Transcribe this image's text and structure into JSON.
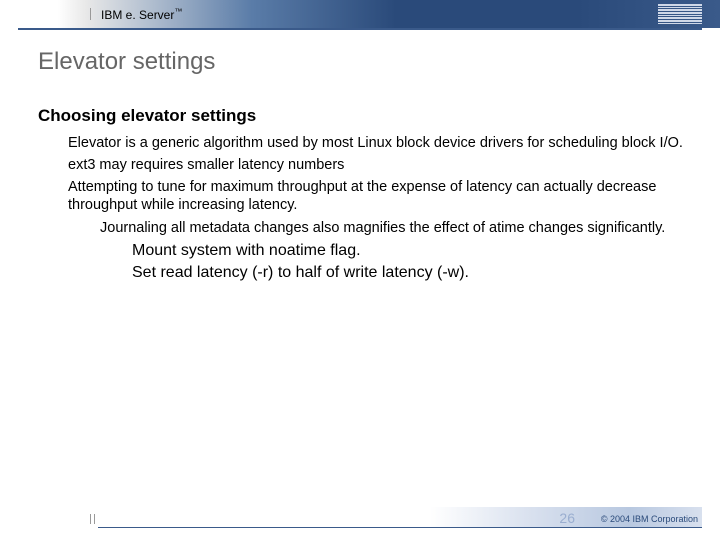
{
  "header": {
    "brand_prefix": "IBM e. Server",
    "brand_tm": "™"
  },
  "title": "Elevator settings",
  "section_head": "Choosing elevator settings",
  "bullets": {
    "b1": "Elevator is a generic algorithm used by most Linux block device drivers for scheduling block I/O.",
    "b2": "ext3 may requires smaller latency numbers",
    "b3": "Attempting to tune for maximum throughput at the expense of latency can actually decrease throughput while increasing latency.",
    "b3a": "Journaling all metadata changes also magnifies the effect of atime changes significantly.",
    "b3a1": "Mount system with noatime flag.",
    "b3a2": "Set read latency (-r) to half of write latency (-w)."
  },
  "footer": {
    "page": "26",
    "copyright": "© 2004 IBM Corporation"
  }
}
